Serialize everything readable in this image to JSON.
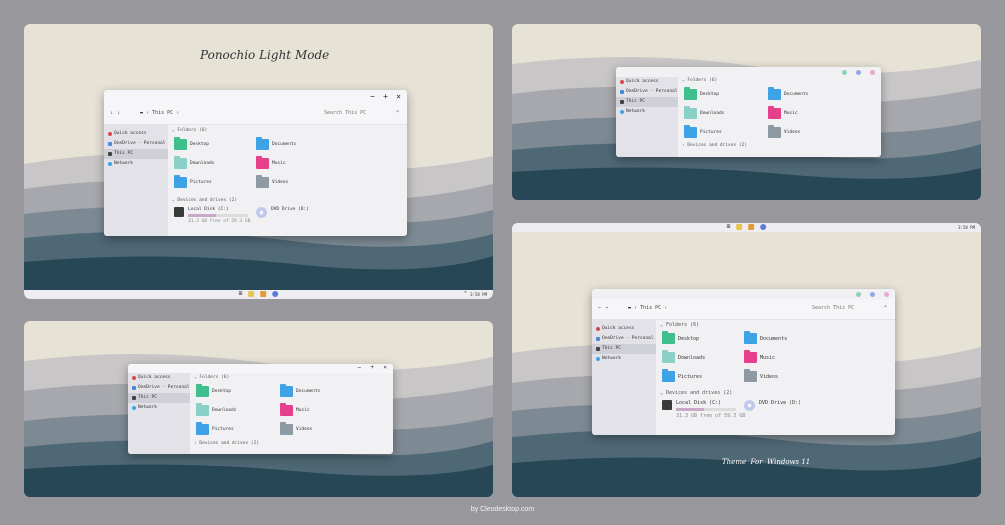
{
  "colors": {
    "page_bg": "#98989c",
    "sky": "#e6e2d6",
    "mountain_dark": "#274656",
    "window_bg": "#f1f1f4",
    "sidebar_bg": "#e2e2e8",
    "folder_green": "#3fbf8d",
    "folder_blue": "#3ea3e6",
    "folder_teal": "#8ad0c6",
    "folder_pink": "#e6408a",
    "folder_gray": "#8d9aa4",
    "dot_green": "#8fd0b7",
    "dot_blue": "#8fa9e6",
    "dot_pink": "#e7a8cf"
  },
  "headline": "Ponochio Light Mode",
  "footer_text": "Theme  For  Windows 11",
  "credit": "by Cleodesktop.com",
  "explorer": {
    "breadcrumb": "This PC",
    "search_placeholder": "Search This PC",
    "controls": {
      "min": "−",
      "max": "+",
      "close": "×"
    },
    "sidebar": [
      {
        "label": "Quick access",
        "icon": "heart-icon",
        "color": "#d24a4a"
      },
      {
        "label": "OneDrive - Personal",
        "icon": "cloud-icon",
        "color": "#4a8ad8"
      },
      {
        "label": "This PC",
        "icon": "computer-icon",
        "color": "#444444",
        "selected": true
      },
      {
        "label": "Network",
        "icon": "network-icon",
        "color": "#3ea3e6"
      }
    ],
    "folders_header": "Folders (6)",
    "folders": [
      {
        "label": "Desktop",
        "icon": "desktop-folder-icon",
        "color": "#3fbf8d"
      },
      {
        "label": "Documents",
        "icon": "documents-folder-icon",
        "color": "#3ea3e6"
      },
      {
        "label": "Downloads",
        "icon": "downloads-folder-icon",
        "color": "#8ad0c6"
      },
      {
        "label": "Music",
        "icon": "music-folder-icon",
        "color": "#e6408a"
      },
      {
        "label": "Pictures",
        "icon": "pictures-folder-icon",
        "color": "#3ea3e6"
      },
      {
        "label": "Videos",
        "icon": "videos-folder-icon",
        "color": "#8d9aa4"
      }
    ],
    "drives_header": "Devices and drives (2)",
    "drives": [
      {
        "label": "Local Disk (C:)",
        "free": "31.3 GB free of 59.3 GB",
        "used_fraction": 0.47
      },
      {
        "label": "DVD Drive (D:)"
      }
    ]
  },
  "taskbar": {
    "time": "3:58 PM",
    "tray_arrow": "^"
  }
}
